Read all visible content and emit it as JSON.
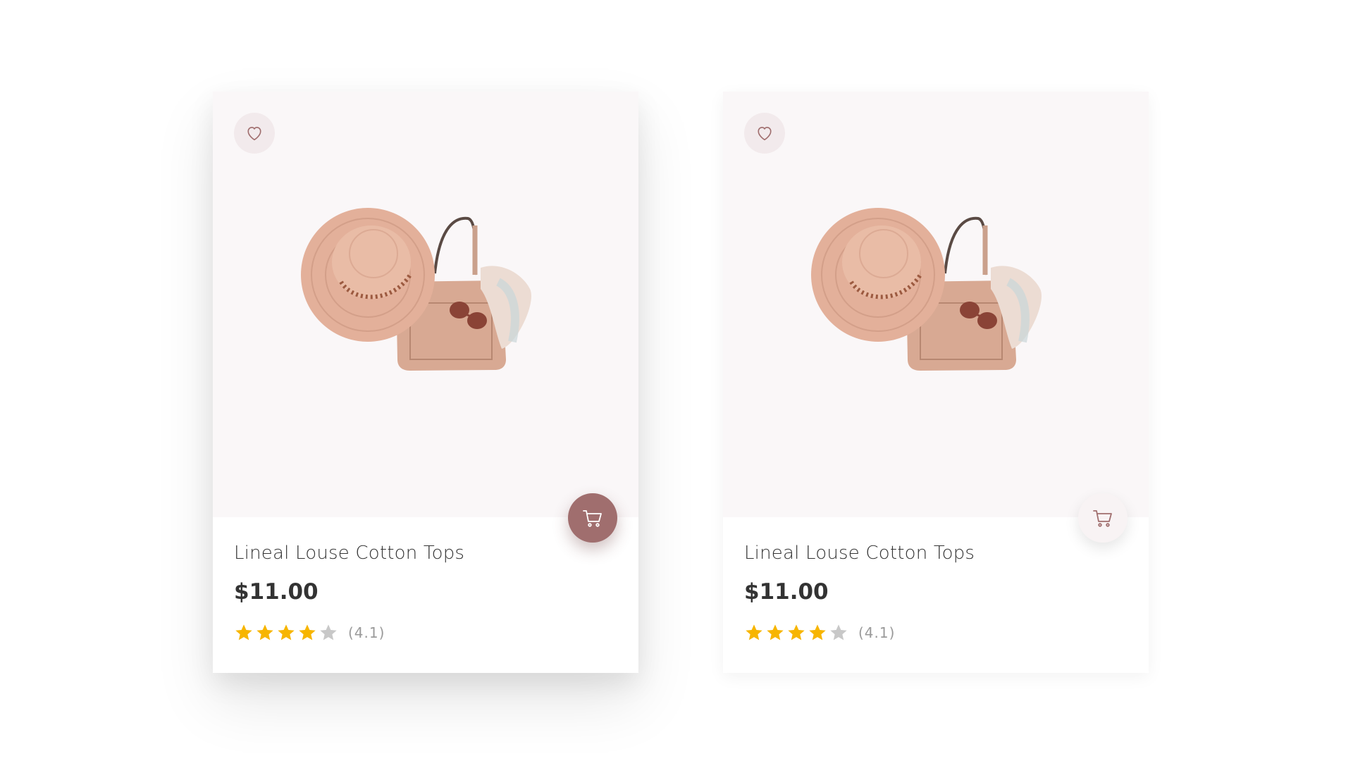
{
  "colors": {
    "accent": "#a06e6e",
    "star_filled": "#f7b500",
    "star_empty": "#c8c8c8"
  },
  "icons": {
    "favorite": "heart-icon",
    "cart": "cart-icon",
    "rating": "star-icon"
  },
  "cards": [
    {
      "state": "hovered",
      "title": "Lineal Louse Cotton Tops",
      "price": "$11.00",
      "rating": 4.1,
      "stars_filled": 4,
      "stars_total": 5,
      "rating_label": "(4.1)"
    },
    {
      "state": "normal",
      "title": "Lineal Louse Cotton Tops",
      "price": "$11.00",
      "rating": 4.1,
      "stars_filled": 4,
      "stars_total": 5,
      "rating_label": "(4.1)"
    }
  ]
}
